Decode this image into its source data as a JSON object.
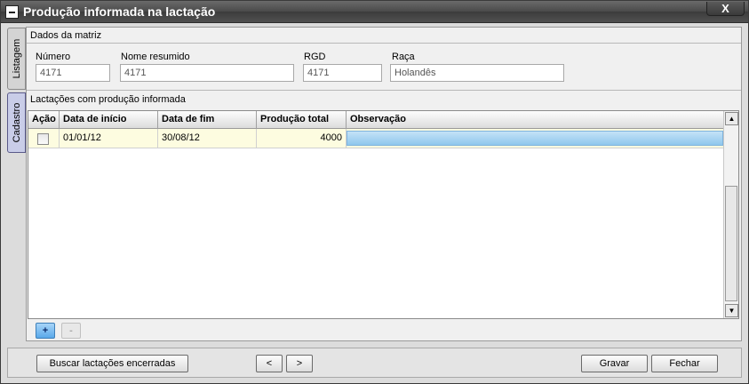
{
  "window": {
    "title": "Produção informada na lactação",
    "close_symbol": "X"
  },
  "tabs": [
    {
      "label": "Listagem"
    },
    {
      "label": "Cadastro"
    }
  ],
  "matriz": {
    "section_label": "Dados da matriz",
    "numero": {
      "label": "Número",
      "value": "4171"
    },
    "nome_resumido": {
      "label": "Nome resumido",
      "value": "4171"
    },
    "rgd": {
      "label": "RGD",
      "value": "4171"
    },
    "raca": {
      "label": "Raça",
      "value": "Holandês"
    }
  },
  "lactacoes": {
    "section_label": "Lactações com produção informada",
    "columns": [
      "Ação",
      "Data de início",
      "Data de fim",
      "Produção total",
      "Observação"
    ],
    "rows": [
      {
        "acao_checked": false,
        "data_inicio": "01/01/12",
        "data_fim": "30/08/12",
        "producao_total": "4000",
        "observacao": ""
      }
    ],
    "add_label": "+",
    "remove_label": "-"
  },
  "footer": {
    "buscar_label": "Buscar lactações encerradas",
    "prev_label": "<",
    "next_label": ">",
    "gravar_label": "Gravar",
    "fechar_label": "Fechar"
  },
  "icons": {
    "window_menu": "window-menu-icon",
    "close": "close-icon",
    "scroll_up": "scroll-up-icon",
    "scroll_down": "scroll-down-icon"
  },
  "colors": {
    "titlebar": "#4a4a4a",
    "row_highlight": "#fdfce0",
    "selection": "#8fc7ed",
    "add_button": "#5aa9ea"
  }
}
